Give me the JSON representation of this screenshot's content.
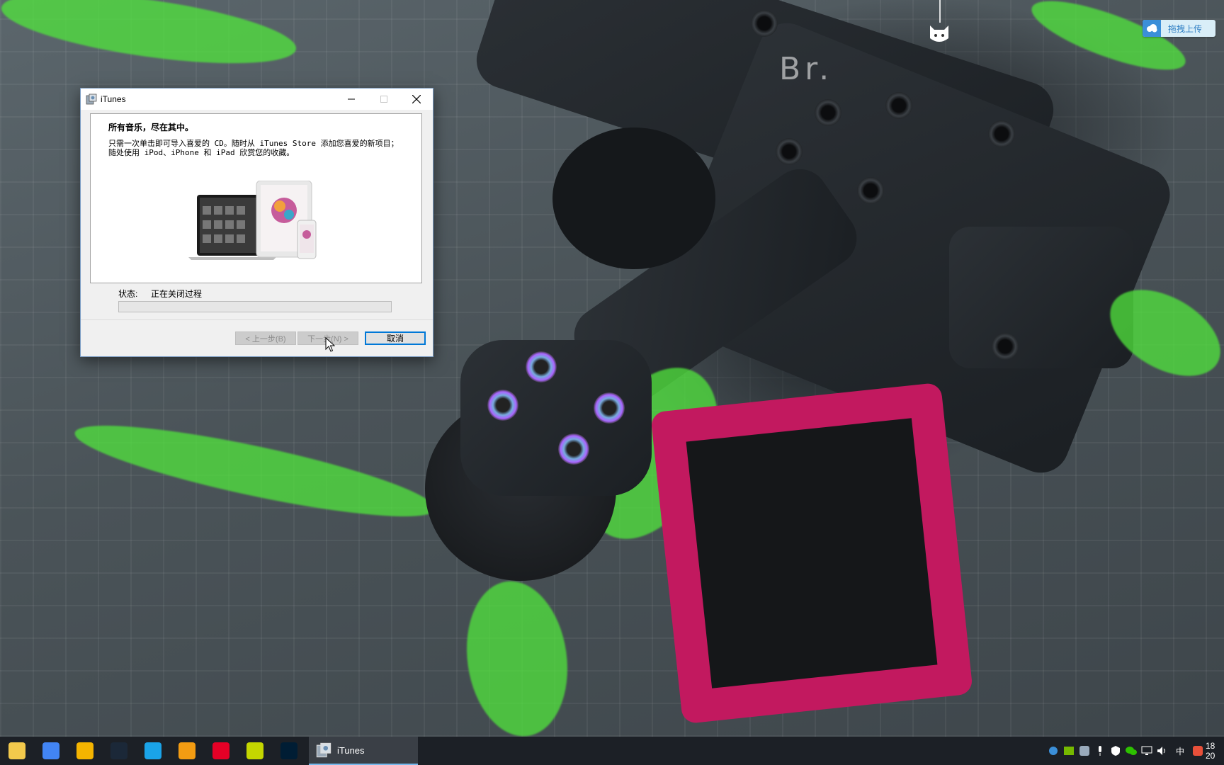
{
  "desktop": {
    "watermark_text": "Br.",
    "upload_widget": {
      "label": "拖拽上传"
    }
  },
  "dialog": {
    "title": "iTunes",
    "headline": "所有音乐，尽在其中。",
    "description": "只需一次单击即可导入喜爱的 CD。随时从 iTunes Store 添加您喜爱的新项目；\n随处使用 iPod、iPhone 和 iPad 欣赏您的收藏。",
    "status_label": "状态:",
    "status_value": "正在关闭过程",
    "progress": 0,
    "buttons": {
      "back": "< 上一步(B)",
      "next": "下一步(N) >",
      "cancel": "取消"
    }
  },
  "taskbar": {
    "pinned": [
      {
        "name": "file-explorer-icon",
        "color": "#f2c94c"
      },
      {
        "name": "chrome-icon",
        "color": "#4285f4"
      },
      {
        "name": "chrome-canary-icon",
        "color": "#f4b400"
      },
      {
        "name": "steam-icon",
        "color": "#1b2838"
      },
      {
        "name": "cortana-c-icon",
        "color": "#1aa3e8"
      },
      {
        "name": "x-app-icon",
        "color": "#f39c12"
      },
      {
        "name": "netease-music-icon",
        "color": "#e60026"
      },
      {
        "name": "yellow-app-icon",
        "color": "#c4d600"
      },
      {
        "name": "photoshop-icon",
        "color": "#001d34"
      }
    ],
    "active_window": "iTunes",
    "tray": {
      "ime": "中",
      "clock_time": "18",
      "clock_date": "20"
    }
  },
  "colors": {
    "accent": "#0078d7",
    "taskbar": "#1c2026",
    "focus_outline": "#0078d7"
  }
}
